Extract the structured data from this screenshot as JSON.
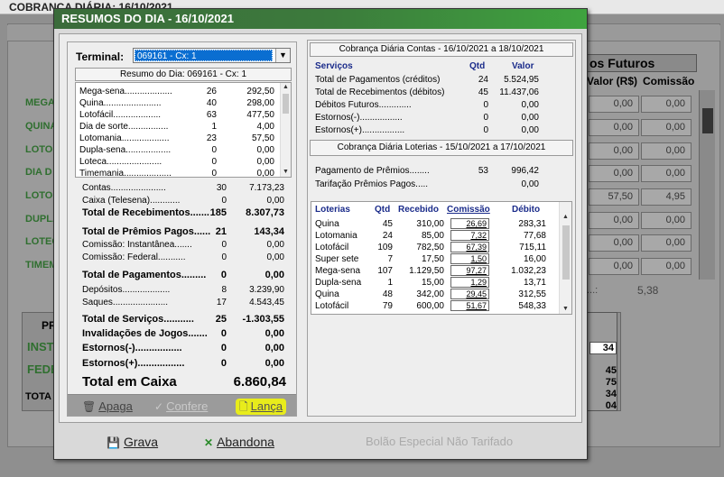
{
  "background": {
    "title": "COBRANÇA DIÁRIA: 16/10/2021",
    "section_header": "os Futuros",
    "col_valor": "Valor (R$)",
    "col_comissao": "Comissão",
    "row_labels": [
      "MEGA",
      "QUINA",
      "LOTOF",
      "DIA D",
      "LOTO",
      "DUPLA",
      "LOTEC",
      "TIMEM"
    ],
    "valor_cells": [
      "0,00",
      "0,00",
      "0,00",
      "0,00",
      "57,50",
      "0,00",
      "0,00",
      "0,00"
    ],
    "comissao_cells": [
      "0,00",
      "0,00",
      "0,00",
      "0,00",
      "4,95",
      "0,00",
      "0,00",
      "0,00"
    ],
    "total_dots": "...:",
    "total_value": "5,38",
    "lower_header": "PR",
    "lower_labels": [
      "INST",
      "FEDE"
    ],
    "lower_total": "TOTA",
    "lower_right": [
      "34",
      "45",
      "75",
      "34",
      "04"
    ]
  },
  "dialog": {
    "title": "RESUMOS DO DIA - 16/10/2021",
    "terminal_label": "Terminal:",
    "terminal_value": "069161 - Cx: 1",
    "summary_header": "Resumo do Dia: 069161 - Cx: 1",
    "games": [
      {
        "name": "Mega-sena",
        "qty": "26",
        "value": "292,50"
      },
      {
        "name": "Quina",
        "qty": "40",
        "value": "298,00"
      },
      {
        "name": "Lotofácil",
        "qty": "63",
        "value": "477,50"
      },
      {
        "name": "Dia de sorte",
        "qty": "1",
        "value": "4,00"
      },
      {
        "name": "Lotomania",
        "qty": "23",
        "value": "57,50"
      },
      {
        "name": "Dupla-sena",
        "qty": "0",
        "value": "0,00"
      },
      {
        "name": "Loteca",
        "qty": "0",
        "value": "0,00"
      },
      {
        "name": "Timemania",
        "qty": "0",
        "value": "0,00"
      }
    ],
    "summary": [
      {
        "name": "Contas",
        "qty": "30",
        "value": "7.173,23",
        "bold": false
      },
      {
        "name": "Caixa (Telesena)",
        "qty": "0",
        "value": "0,00",
        "bold": false
      },
      {
        "name": "Total de Recebimentos",
        "qty": "185",
        "value": "8.307,73",
        "bold": true
      },
      {
        "name": "Total de Prêmios Pagos",
        "qty": "21",
        "value": "143,34",
        "bold": true
      },
      {
        "name": "Comissão: Instantânea",
        "qty": "0",
        "value": "0,00",
        "bold": false
      },
      {
        "name": "Comissão: Federal",
        "qty": "0",
        "value": "0,00",
        "bold": false
      },
      {
        "name": "Total de Pagamentos",
        "qty": "0",
        "value": "0,00",
        "bold": true
      },
      {
        "name": "Depósitos",
        "qty": "8",
        "value": "3.239,90",
        "bold": false
      },
      {
        "name": "Saques",
        "qty": "17",
        "value": "4.543,45",
        "bold": false
      },
      {
        "name": "Total de Serviços",
        "qty": "25",
        "value": "-1.303,55",
        "bold": true
      },
      {
        "name": "Invalidações de Jogos",
        "qty": "0",
        "value": "0,00",
        "bold": true
      },
      {
        "name": "Estornos(-)",
        "qty": "0",
        "value": "0,00",
        "bold": true
      },
      {
        "name": "Estornos(+)",
        "qty": "0",
        "value": "0,00",
        "bold": true
      }
    ],
    "total_caixa_label": "Total em Caixa",
    "total_caixa_value": "6.860,84",
    "buttons": {
      "apaga": "Apaga",
      "confere": "Confere",
      "lanca": "Lança"
    },
    "contas": {
      "header": "Cobrança Diária Contas - 16/10/2021 a 18/10/2021",
      "col_servicos": "Serviços",
      "col_qtd": "Qtd",
      "col_valor": "Valor",
      "rows": [
        {
          "name": "Total de Pagamentos (créditos)",
          "qty": "24",
          "value": "5.524,95"
        },
        {
          "name": "Total de Recebimentos (débitos)",
          "qty": "45",
          "value": "11.437,06"
        },
        {
          "name": "Débitos Futuros",
          "qty": "0",
          "value": "0,00"
        },
        {
          "name": "Estornos(-)",
          "qty": "0",
          "value": "0,00"
        },
        {
          "name": "Estornos(+)",
          "qty": "0",
          "value": "0,00"
        }
      ]
    },
    "loterias": {
      "header": "Cobrança Diária Loterias - 15/10/2021 a 17/10/2021",
      "rows": [
        {
          "name": "Pagamento de Prêmios",
          "qty": "53",
          "value": "996,42"
        },
        {
          "name": "Tarifação Prêmios Pagos",
          "qty": "",
          "value": "0,00"
        }
      ],
      "table_headers": [
        "Loterias",
        "Qtd",
        "Recebido",
        "Comissão",
        "Débito"
      ],
      "table_rows": [
        {
          "name": "Quina",
          "qty": "45",
          "rec": "310,00",
          "com": "26,69",
          "deb": "283,31"
        },
        {
          "name": "Lotomania",
          "qty": "24",
          "rec": "85,00",
          "com": "7,32",
          "deb": "77,68"
        },
        {
          "name": "Lotofácil",
          "qty": "109",
          "rec": "782,50",
          "com": "67,39",
          "deb": "715,11"
        },
        {
          "name": "Super sete",
          "qty": "7",
          "rec": "17,50",
          "com": "1,50",
          "deb": "16,00"
        },
        {
          "name": "Mega-sena",
          "qty": "107",
          "rec": "1.129,50",
          "com": "97,27",
          "deb": "1.032,23"
        },
        {
          "name": "Dupla-sena",
          "qty": "1",
          "rec": "15,00",
          "com": "1,29",
          "deb": "13,71"
        },
        {
          "name": "Quina",
          "qty": "48",
          "rec": "342,00",
          "com": "29,45",
          "deb": "312,55"
        },
        {
          "name": "Lotofácil",
          "qty": "79",
          "rec": "600,00",
          "com": "51,67",
          "deb": "548,33"
        }
      ]
    },
    "bottom": {
      "grava": "Grava",
      "abandona": "Abandona",
      "bolao": "Bolão Especial Não Tarifado"
    }
  }
}
